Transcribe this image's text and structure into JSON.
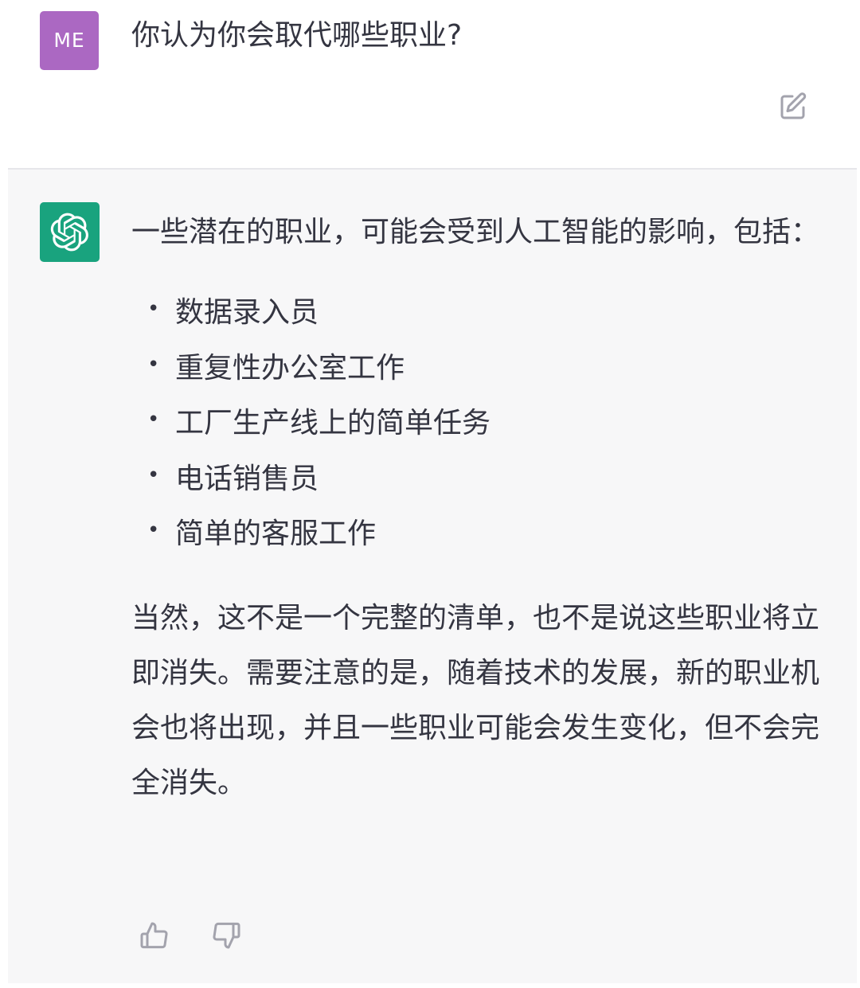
{
  "user_message": {
    "avatar_initials": "ME",
    "avatar_color": "#ab68c2",
    "text": "你认为你会取代哪些职业?",
    "edit_icon": "edit-icon"
  },
  "assistant_message": {
    "avatar_icon": "openai-logo-icon",
    "avatar_color": "#19a37e",
    "intro": "一些潜在的职业，可能会受到人工智能的影响，包括：",
    "bullets": [
      "数据录入员",
      "重复性办公室工作",
      "工厂生产线上的简单任务",
      "电话销售员",
      "简单的客服工作"
    ],
    "outro": "当然，这不是一个完整的清单，也不是说这些职业将立即消失。需要注意的是，随着技术的发展，新的职业机会也将出现，并且一些职业可能会发生变化，但不会完全消失。",
    "feedback_icons": [
      "thumbs-up-icon",
      "thumbs-down-icon"
    ]
  },
  "colors": {
    "assistant_background": "#f7f7f8",
    "text": "#343541",
    "icon": "#acacbe"
  }
}
